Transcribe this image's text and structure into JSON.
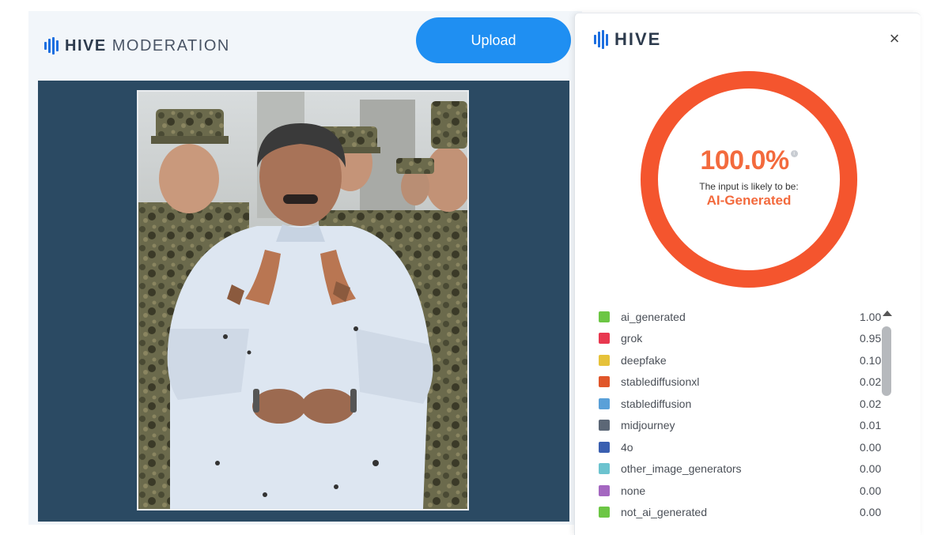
{
  "app": {
    "brand_bold": "HIVE",
    "brand_light": "MODERATION",
    "upload_label": "Upload"
  },
  "panel": {
    "brand": "HIVE",
    "close_glyph": "×",
    "score": "100.0%",
    "info_glyph": "i",
    "likely_text": "The input is likely to be:",
    "verdict": "AI-Generated",
    "gauge_fraction": 1.0,
    "gauge_color": "#f4552e"
  },
  "classes": [
    {
      "name": "ai_generated",
      "value": "1.00",
      "color": "#6cc644"
    },
    {
      "name": "grok",
      "value": "0.95",
      "color": "#e8384f"
    },
    {
      "name": "deepfake",
      "value": "0.10",
      "color": "#e6c23a"
    },
    {
      "name": "stablediffusionxl",
      "value": "0.02",
      "color": "#e0562a"
    },
    {
      "name": "stablediffusion",
      "value": "0.02",
      "color": "#5aa0d8"
    },
    {
      "name": "midjourney",
      "value": "0.01",
      "color": "#5c6776"
    },
    {
      "name": "4o",
      "value": "0.00",
      "color": "#3a5fb0"
    },
    {
      "name": "other_image_generators",
      "value": "0.00",
      "color": "#6cc3cf"
    },
    {
      "name": "none",
      "value": "0.00",
      "color": "#a467c0"
    },
    {
      "name": "not_ai_generated",
      "value": "0.00",
      "color": "#6cc644"
    }
  ],
  "colors": {
    "accent": "#1f8ff2",
    "score": "#f36a3d",
    "frame": "#2b4a63"
  }
}
